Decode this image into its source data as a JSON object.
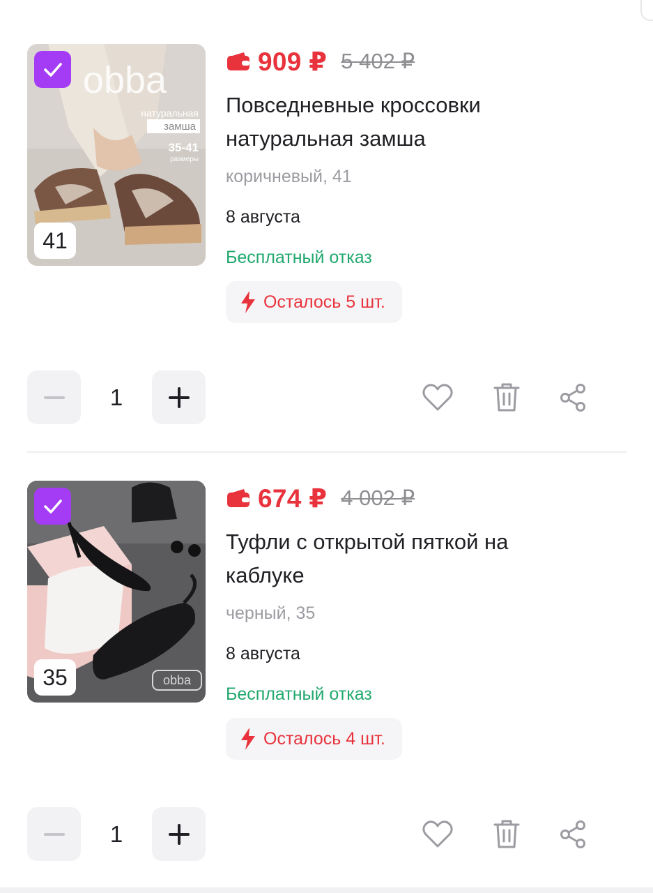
{
  "items": [
    {
      "price": "909 ₽",
      "old_price": "5 402 ₽",
      "title_line1": "Повседневные кроссовки",
      "title_line2": "натуральная замша",
      "variant": "коричневый, 41",
      "delivery": "8 августа",
      "free_return": "Бесплатный отказ",
      "stock": "Осталось 5 шт.",
      "size_badge": "41",
      "quantity": "1",
      "image_brand": "obba",
      "image_caption_1": "натуральная",
      "image_caption_2": "замша",
      "image_sizes": "35-41",
      "image_sizes_label": "размеры"
    },
    {
      "price": "674 ₽",
      "old_price": "4 002 ₽",
      "title_line1": "Туфли с открытой пяткой на",
      "title_line2": "каблуке",
      "variant": "черный, 35",
      "delivery": "8 августа",
      "free_return": "Бесплатный отказ",
      "stock": "Осталось 4 шт.",
      "size_badge": "35",
      "quantity": "1",
      "image_brand": "obba"
    }
  ],
  "colors": {
    "accent_price": "#e8333c",
    "checkbox": "#a43cf6",
    "free_return": "#21a86d",
    "muted": "#9b9ba1"
  },
  "icons": [
    "wallet-icon",
    "check-icon",
    "lightning-icon",
    "minus-icon",
    "plus-icon",
    "heart-icon",
    "trash-icon",
    "share-icon"
  ]
}
